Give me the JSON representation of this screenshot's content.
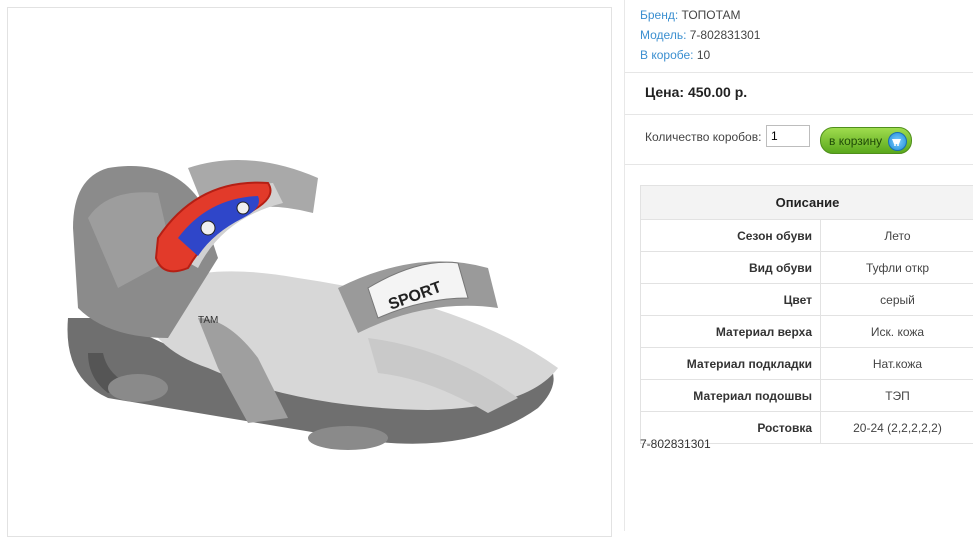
{
  "product": {
    "brand_label": "Бренд:",
    "brand": "ТОПОТАМ",
    "model_label": "Модель:",
    "model": "7-802831301",
    "box_label": "В коробе:",
    "box_qty": "10",
    "price_text": "Цена: 450.00 р.",
    "qty_label": "Количество коробов:",
    "qty_value": "1",
    "cart_button": "в корзину",
    "article_code": "7-802831301"
  },
  "description": {
    "title": "Описание",
    "rows": [
      {
        "label": "Сезон обуви",
        "value": "Лето"
      },
      {
        "label": "Вид обуви",
        "value": "Туфли откр"
      },
      {
        "label": "Цвет",
        "value": "серый"
      },
      {
        "label": "Материал верха",
        "value": "Иск. кожа"
      },
      {
        "label": "Материал подкладки",
        "value": "Нат.кожа"
      },
      {
        "label": "Материал подошвы",
        "value": "ТЭП"
      },
      {
        "label": "Ростовка",
        "value": "20-24 (2,2,2,2,2)"
      }
    ]
  },
  "image": {
    "strap_text": "SPORT",
    "logo_fragment": "TAM"
  },
  "colors": {
    "link": "#3b8fd0",
    "cart_button": "#6cba2a"
  }
}
